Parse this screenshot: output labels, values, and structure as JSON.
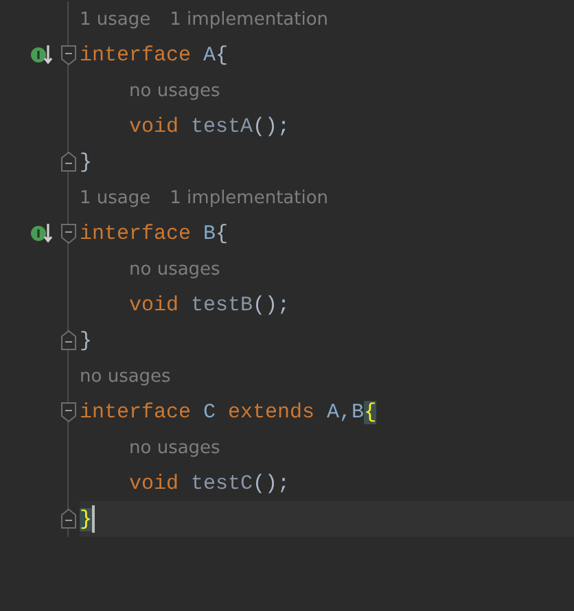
{
  "editor": {
    "lines": [
      {
        "kind": "hint",
        "items": [
          "1 usage",
          "1 implementation"
        ]
      },
      {
        "kind": "open",
        "gutter_icon": true,
        "current": false,
        "tokens": [
          {
            "text": "interface ",
            "kind": "keyword"
          },
          {
            "text": "A",
            "kind": "type"
          },
          {
            "text": "{",
            "kind": "punct"
          }
        ],
        "children": [
          {
            "kind": "hint",
            "items": [
              "no usages"
            ]
          },
          {
            "kind": "statement",
            "gutter_icon": false,
            "current": false,
            "tokens": [
              {
                "text": "void ",
                "kind": "keyword"
              },
              {
                "text": "testA",
                "kind": "method"
              },
              {
                "text": "();",
                "kind": "punct"
              }
            ]
          }
        ]
      },
      {
        "kind": "close",
        "gutter_icon": false,
        "current": false,
        "tokens": [
          {
            "text": "}",
            "kind": "punct"
          }
        ]
      },
      {
        "kind": "hint",
        "items": [
          "1 usage",
          "1 implementation"
        ]
      },
      {
        "kind": "open",
        "gutter_icon": true,
        "current": false,
        "tokens": [
          {
            "text": "interface ",
            "kind": "keyword"
          },
          {
            "text": "B",
            "kind": "type"
          },
          {
            "text": "{",
            "kind": "punct"
          }
        ],
        "children": [
          {
            "kind": "hint",
            "items": [
              "no usages"
            ]
          },
          {
            "kind": "statement",
            "gutter_icon": false,
            "current": false,
            "tokens": [
              {
                "text": "void ",
                "kind": "keyword"
              },
              {
                "text": "testB",
                "kind": "method"
              },
              {
                "text": "();",
                "kind": "punct"
              }
            ]
          }
        ]
      },
      {
        "kind": "close",
        "gutter_icon": false,
        "current": false,
        "tokens": [
          {
            "text": "}",
            "kind": "punct"
          }
        ]
      },
      {
        "kind": "hint",
        "items": [
          "no usages"
        ]
      },
      {
        "kind": "open",
        "gutter_icon": false,
        "current": false,
        "tokens": [
          {
            "text": "interface ",
            "kind": "keyword"
          },
          {
            "text": "C ",
            "kind": "type"
          },
          {
            "text": "extends ",
            "kind": "keyword"
          },
          {
            "text": "A,B",
            "kind": "type"
          },
          {
            "text": "{",
            "kind": "brace-match"
          }
        ],
        "children": [
          {
            "kind": "hint",
            "items": [
              "no usages"
            ]
          },
          {
            "kind": "statement",
            "gutter_icon": false,
            "current": false,
            "tokens": [
              {
                "text": "void ",
                "kind": "keyword"
              },
              {
                "text": "testC",
                "kind": "method"
              },
              {
                "text": "();",
                "kind": "punct"
              }
            ]
          }
        ]
      },
      {
        "kind": "close",
        "gutter_icon": false,
        "current": true,
        "tokens": [
          {
            "text": "}",
            "kind": "brace-match"
          }
        ]
      }
    ]
  }
}
